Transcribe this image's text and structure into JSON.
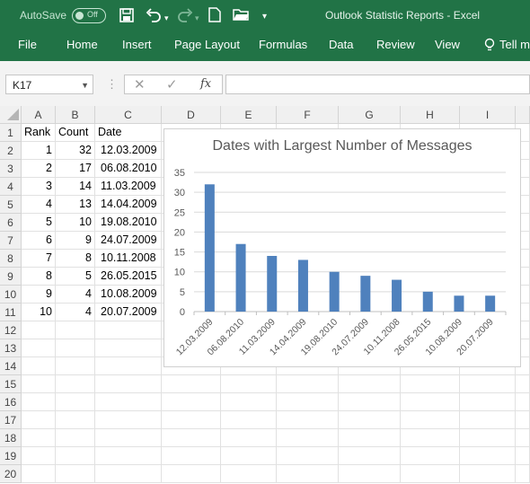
{
  "titlebar": {
    "autosave_label": "AutoSave",
    "autosave_state": "Off",
    "window_title": "Outlook Statistic Reports  -  Excel"
  },
  "ribbon": {
    "tabs": [
      "File",
      "Home",
      "Insert",
      "Page Layout",
      "Formulas",
      "Data",
      "Review",
      "View",
      "Tell me"
    ]
  },
  "formula_bar": {
    "name_box": "K17",
    "fx_label": "fx",
    "formula": ""
  },
  "sheet": {
    "columns": [
      "A",
      "B",
      "C",
      "D",
      "E",
      "F",
      "G",
      "H",
      "I"
    ],
    "row_numbers": [
      "1",
      "2",
      "3",
      "4",
      "5",
      "6",
      "7",
      "8",
      "9",
      "10",
      "11",
      "12",
      "13",
      "14",
      "15",
      "16",
      "17",
      "18",
      "19",
      "20"
    ],
    "headers": [
      "Rank",
      "Count",
      "Date"
    ],
    "rows": [
      [
        "1",
        "32",
        "12.03.2009"
      ],
      [
        "2",
        "17",
        "06.08.2010"
      ],
      [
        "3",
        "14",
        "11.03.2009"
      ],
      [
        "4",
        "13",
        "14.04.2009"
      ],
      [
        "5",
        "10",
        "19.08.2010"
      ],
      [
        "6",
        "9",
        "24.07.2009"
      ],
      [
        "7",
        "8",
        "10.11.2008"
      ],
      [
        "8",
        "5",
        "26.05.2015"
      ],
      [
        "9",
        "4",
        "10.08.2009"
      ],
      [
        "10",
        "4",
        "20.07.2009"
      ]
    ]
  },
  "colors": {
    "ribbon": "#217346",
    "bar": "#4f81bd"
  },
  "chart_data": {
    "type": "bar",
    "title": "Dates with Largest Number of Messages",
    "categories": [
      "12.03.2009",
      "06.08.2010",
      "11.03.2009",
      "14.04.2009",
      "19.08.2010",
      "24.07.2009",
      "10.11.2008",
      "26.05.2015",
      "10.08.2009",
      "20.07.2009"
    ],
    "values": [
      32,
      17,
      14,
      13,
      10,
      9,
      8,
      5,
      4,
      4
    ],
    "ylim": [
      0,
      35
    ],
    "yticks": [
      "0",
      "5",
      "10",
      "15",
      "20",
      "25",
      "30",
      "35"
    ],
    "grid": true,
    "xlabel": "",
    "ylabel": ""
  }
}
